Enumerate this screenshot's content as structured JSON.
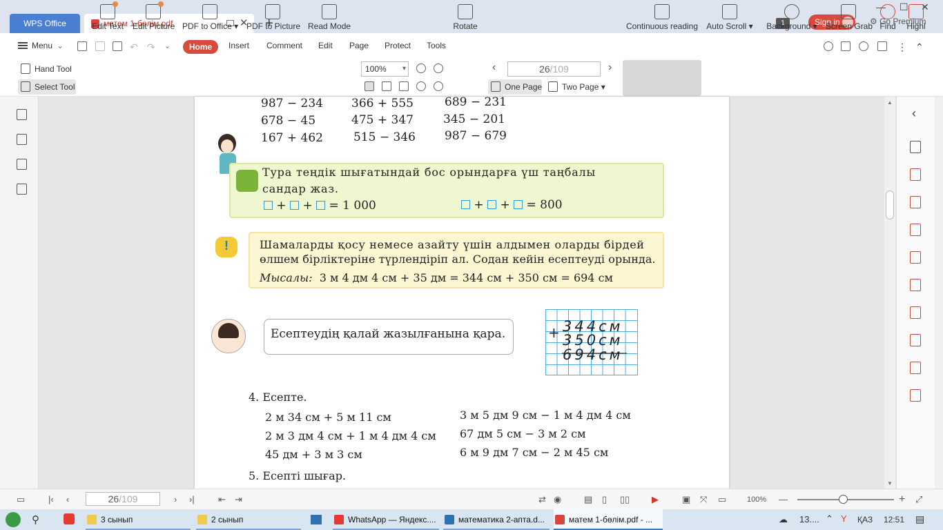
{
  "titlebar": {
    "app_tab": "WPS Office",
    "doc_tab": "матем 1-бөлім.pdf",
    "notification_count": "1",
    "sign_in": "Sign in",
    "go_premium": "Go Premium"
  },
  "menubar": {
    "menu": "Menu",
    "tabs": [
      "Home",
      "Insert",
      "Comment",
      "Edit",
      "Page",
      "Protect",
      "Tools"
    ]
  },
  "ribbon": {
    "hand_tool": "Hand Tool",
    "select_tool": "Select Tool",
    "edit_text": "Edit Text",
    "edit_picture": "Edit Picture",
    "pdf_to_office": "PDF to Office",
    "pdf_to_picture": "PDF to Picture",
    "read_mode": "Read Mode",
    "zoom": "100%",
    "rotate": "Rotate",
    "page_current": "26",
    "page_total": "/109",
    "one_page": "One Page",
    "two_page": "Two Page",
    "continuous_reading": "Continuous reading",
    "auto_scroll": "Auto Scroll",
    "background": "Background",
    "screen_grab": "Screen Grab",
    "find": "Find",
    "highlight": "Highl"
  },
  "document": {
    "top_exercises": [
      [
        "987 − 234",
        "366 + 555",
        "689 − 231"
      ],
      [
        "678 − 45",
        "475 + 347",
        "345 − 201"
      ],
      [
        "167 + 462",
        "515 − 346",
        "987 − 679"
      ]
    ],
    "green_task_line1": "Тура теңдік шығатындай бос орындарға үш таңбалы",
    "green_task_line2": "сандар жаз.",
    "eq1": "= 1 000",
    "eq2": "= 800",
    "yellow_line1": "Шамаларды қосу немесе азайту үшін алдымен оларды бірдей",
    "yellow_line2": "өлшем бірліктеріне түрлендіріп ал. Содан кейін есептеуді орында.",
    "example_label": "Мысалы:",
    "example_text": "3 м 4 дм 4 см + 35 дм = 344 см + 350 см = 694 см",
    "bubble_text": "Есептеудің қалай жазылғанына қара.",
    "grid_rows": [
      "344см",
      "350см",
      "694см"
    ],
    "grid_plus": "+",
    "task4_title": "4. Есепте.",
    "task4_left": [
      "2 м 34 см + 5 м 11 см",
      "2 м 3 дм 4 см + 1 м 4 дм 4 см",
      "45 дм + 3 м 3 см"
    ],
    "task4_right": [
      "3 м 5 дм 9 см − 1 м 4 дм 4 см",
      "67 дм 5 см − 3 м 2 см",
      "6 м 9 дм 7 см − 2 м 45 см"
    ],
    "task5_title": "5. Есепті шығар."
  },
  "statusbar": {
    "page_current": "26",
    "page_total": "/109",
    "zoom": "100%"
  },
  "taskbar": {
    "items": [
      "3 сынып",
      "2 сынып",
      "WhatsApp — Яндекс....",
      "математика 2-апта.d...",
      "матем 1-бөлім.pdf - ..."
    ],
    "tray_text": "13....",
    "lang": "ҚАЗ",
    "time": "12:51"
  },
  "colors": {
    "accent": "#d74a3c",
    "wps_tab": "#4a7fd1",
    "grid": "#2f9bd6"
  }
}
